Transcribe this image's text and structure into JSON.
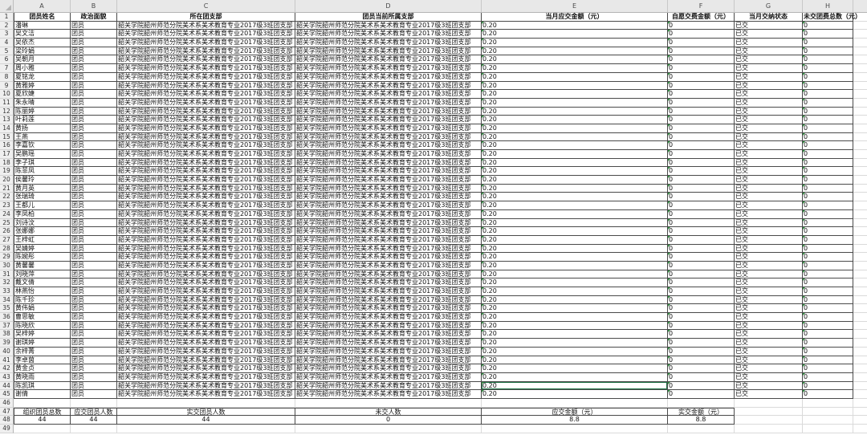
{
  "column_letters": [
    "A",
    "B",
    "C",
    "D",
    "E",
    "F",
    "G",
    "H"
  ],
  "row_numbers": [
    1,
    2,
    3,
    4,
    5,
    6,
    7,
    8,
    9,
    10,
    11,
    12,
    13,
    14,
    15,
    16,
    17,
    18,
    19,
    20,
    21,
    22,
    23,
    24,
    25,
    26,
    27,
    28,
    29,
    30,
    31,
    32,
    33,
    34,
    35,
    36,
    37,
    38,
    39,
    40,
    41,
    42,
    43,
    44,
    45,
    46,
    47,
    48,
    49
  ],
  "headers": [
    "团员姓名",
    "政治面貌",
    "所在团支部",
    "团员当前所属支部",
    "当月应交金额（元）",
    "自愿交费金额（元）",
    "当月交纳状态",
    "未交团费总数（元）"
  ],
  "rows": [
    [
      "潘琳",
      "团员",
      "韶关学院韶州师范分院美术系美术教育专业2017级3班团支部",
      "韶关学院韶州师范分院美术系美术教育专业2017级3班团支部",
      "0.20",
      "0",
      "已交",
      "0"
    ],
    [
      "吴文洁",
      "团员",
      "韶关学院韶州师范分院美术系美术教育专业2017级3班团支部",
      "韶关学院韶州师范分院美术系美术教育专业2017级3班团支部",
      "0.20",
      "0",
      "已交",
      "0"
    ],
    [
      "吴依杰",
      "团员",
      "韶关学院韶州师范分院美术系美术教育专业2017级3班团支部",
      "韶关学院韶州师范分院美术系美术教育专业2017级3班团支部",
      "0.20",
      "0",
      "已交",
      "0"
    ],
    [
      "梁玲娟",
      "团员",
      "韶关学院韶州师范分院美术系美术教育专业2017级3班团支部",
      "韶关学院韶州师范分院美术系美术教育专业2017级3班团支部",
      "0.20",
      "0",
      "已交",
      "0"
    ],
    [
      "吴朝月",
      "团员",
      "韶关学院韶州师范分院美术系美术教育专业2017级3班团支部",
      "韶关学院韶州师范分院美术系美术教育专业2017级3班团支部",
      "0.20",
      "0",
      "已交",
      "0"
    ],
    [
      "周小雅",
      "团员",
      "韶关学院韶州师范分院美术系美术教育专业2017级3班团支部",
      "韶关学院韶州师范分院美术系美术教育专业2017级3班团支部",
      "0.20",
      "0",
      "已交",
      "0"
    ],
    [
      "夏铭龙",
      "团员",
      "韶关学院韶州师范分院美术系美术教育专业2017级3班团支部",
      "韶关学院韶州师范分院美术系美术教育专业2017级3班团支部",
      "0.20",
      "0",
      "已交",
      "0"
    ],
    [
      "黄雅婷",
      "团员",
      "韶关学院韶州师范分院美术系美术教育专业2017级3班团支部",
      "韶关学院韶州师范分院美术系美术教育专业2017级3班团支部",
      "0.20",
      "0",
      "已交",
      "0"
    ],
    [
      "夏欣婕",
      "团员",
      "韶关学院韶州师范分院美术系美术教育专业2017级3班团支部",
      "韶关学院韶州师范分院美术系美术教育专业2017级3班团支部",
      "0.20",
      "0",
      "已交",
      "0"
    ],
    [
      "朱永晴",
      "团员",
      "韶关学院韶州师范分院美术系美术教育专业2017级3班团支部",
      "韶关学院韶州师范分院美术系美术教育专业2017级3班团支部",
      "0.20",
      "0",
      "已交",
      "0"
    ],
    [
      "陈丽婷",
      "团员",
      "韶关学院韶州师范分院美术系美术教育专业2017级3班团支部",
      "韶关学院韶州师范分院美术系美术教育专业2017级3班团支部",
      "0.20",
      "0",
      "已交",
      "0"
    ],
    [
      "叶莉莲",
      "团员",
      "韶关学院韶州师范分院美术系美术教育专业2017级3班团支部",
      "韶关学院韶州师范分院美术系美术教育专业2017级3班团支部",
      "0.20",
      "0",
      "已交",
      "0"
    ],
    [
      "黄扬",
      "团员",
      "韶关学院韶州师范分院美术系美术教育专业2017级3班团支部",
      "韶关学院韶州师范分院美术系美术教育专业2017级3班团支部",
      "0.20",
      "0",
      "已交",
      "0"
    ],
    [
      "王燕",
      "团员",
      "韶关学院韶州师范分院美术系美术教育专业2017级3班团支部",
      "韶关学院韶州师范分院美术系美术教育专业2017级3班团支部",
      "0.20",
      "0",
      "已交",
      "0"
    ],
    [
      "李嘉钦",
      "团员",
      "韶关学院韶州师范分院美术系美术教育专业2017级3班团支部",
      "韶关学院韶州师范分院美术系美术教育专业2017级3班团支部",
      "0.20",
      "0",
      "已交",
      "0"
    ],
    [
      "吴鹏瑶",
      "团员",
      "韶关学院韶州师范分院美术系美术教育专业2017级3班团支部",
      "韶关学院韶州师范分院美术系美术教育专业2017级3班团支部",
      "0.20",
      "0",
      "已交",
      "0"
    ],
    [
      "李子琪",
      "团员",
      "韶关学院韶州师范分院美术系美术教育专业2017级3班团支部",
      "韶关学院韶州师范分院美术系美术教育专业2017级3班团支部",
      "0.20",
      "0",
      "已交",
      "0"
    ],
    [
      "陈菲凤",
      "团员",
      "韶关学院韶州师范分院美术系美术教育专业2017级3班团支部",
      "韶关学院韶州师范分院美术系美术教育专业2017级3班团支部",
      "0.20",
      "0",
      "已交",
      "0"
    ],
    [
      "侯馨玲",
      "团员",
      "韶关学院韶州师范分院美术系美术教育专业2017级3班团支部",
      "韶关学院韶州师范分院美术系美术教育专业2017级3班团支部",
      "0.20",
      "0",
      "已交",
      "0"
    ],
    [
      "黄月英",
      "团员",
      "韶关学院韶州师范分院美术系美术教育专业2017级3班团支部",
      "韶关学院韶州师范分院美术系美术教育专业2017级3班团支部",
      "0.20",
      "0",
      "已交",
      "0"
    ],
    [
      "张瑞琦",
      "团员",
      "韶关学院韶州师范分院美术系美术教育专业2017级3班团支部",
      "韶关学院韶州师范分院美术系美术教育专业2017级3班团支部",
      "0.20",
      "0",
      "已交",
      "0"
    ],
    [
      "王都儿",
      "团员",
      "韶关学院韶州师范分院美术系美术教育专业2017级3班团支部",
      "韶关学院韶州师范分院美术系美术教育专业2017级3班团支部",
      "0.20",
      "0",
      "已交",
      "0"
    ],
    [
      "李凤柏",
      "团员",
      "韶关学院韶州师范分院美术系美术教育专业2017级3班团支部",
      "韶关学院韶州师范分院美术系美术教育专业2017级3班团支部",
      "0.20",
      "0",
      "已交",
      "0"
    ],
    [
      "刘诗汶",
      "团员",
      "韶关学院韶州师范分院美术系美术教育专业2017级3班团支部",
      "韶关学院韶州师范分院美术系美术教育专业2017级3班团支部",
      "0.20",
      "0",
      "已交",
      "0"
    ],
    [
      "张娜娜",
      "团员",
      "韶关学院韶州师范分院美术系美术教育专业2017级3班团支部",
      "韶关学院韶州师范分院美术系美术教育专业2017级3班团支部",
      "0.20",
      "0",
      "已交",
      "0"
    ],
    [
      "王梓虹",
      "团员",
      "韶关学院韶州师范分院美术系美术教育专业2017级3班团支部",
      "韶关学院韶州师范分院美术系美术教育专业2017级3班团支部",
      "0.20",
      "0",
      "已交",
      "0"
    ],
    [
      "吴婧婷",
      "团员",
      "韶关学院韶州师范分院美术系美术教育专业2017级3班团支部",
      "韶关学院韶州师范分院美术系美术教育专业2017级3班团支部",
      "0.20",
      "0",
      "已交",
      "0"
    ],
    [
      "陈婉彤",
      "团员",
      "韶关学院韶州师范分院美术系美术教育专业2017级3班团支部",
      "韶关学院韶州师范分院美术系美术教育专业2017级3班团支部",
      "0.20",
      "0",
      "已交",
      "0"
    ],
    [
      "黄馨馨",
      "团员",
      "韶关学院韶州师范分院美术系美术教育专业2017级3班团支部",
      "韶关学院韶州师范分院美术系美术教育专业2017级3班团支部",
      "0.20",
      "0",
      "已交",
      "0"
    ],
    [
      "刘晓萍",
      "团员",
      "韶关学院韶州师范分院美术系美术教育专业2017级3班团支部",
      "韶关学院韶州师范分院美术系美术教育专业2017级3班团支部",
      "0.20",
      "0",
      "已交",
      "0"
    ],
    [
      "戴文倩",
      "团员",
      "韶关学院韶州师范分院美术系美术教育专业2017级3班团支部",
      "韶关学院韶州师范分院美术系美术教育专业2017级3班团支部",
      "0.20",
      "0",
      "已交",
      "0"
    ],
    [
      "林燕怡",
      "团员",
      "韶关学院韶州师范分院美术系美术教育专业2017级3班团支部",
      "韶关学院韶州师范分院美术系美术教育专业2017级3班团支部",
      "0.20",
      "0",
      "已交",
      "0"
    ],
    [
      "陈千珍",
      "团员",
      "韶关学院韶州师范分院美术系美术教育专业2017级3班团支部",
      "韶关学院韶州师范分院美术系美术教育专业2017级3班团支部",
      "0.20",
      "0",
      "已交",
      "0"
    ],
    [
      "黄伟娟",
      "团员",
      "韶关学院韶州师范分院美术系美术教育专业2017级3班团支部",
      "韶关学院韶州师范分院美术系美术教育专业2017级3班团支部",
      "0.20",
      "0",
      "已交",
      "0"
    ],
    [
      "曹思敏",
      "团员",
      "韶关学院韶州师范分院美术系美术教育专业2017级3班团支部",
      "韶关学院韶州师范分院美术系美术教育专业2017级3班团支部",
      "0.20",
      "0",
      "已交",
      "0"
    ],
    [
      "陈晓欣",
      "团员",
      "韶关学院韶州师范分院美术系美术教育专业2017级3班团支部",
      "韶关学院韶州师范分院美术系美术教育专业2017级3班团支部",
      "0.20",
      "0",
      "已交",
      "0"
    ],
    [
      "吴梓婷",
      "团员",
      "韶关学院韶州师范分院美术系美术教育专业2017级3班团支部",
      "韶关学院韶州师范分院美术系美术教育专业2017级3班团支部",
      "0.20",
      "0",
      "已交",
      "0"
    ],
    [
      "谢琪婷",
      "团员",
      "韶关学院韶州师范分院美术系美术教育专业2017级3班团支部",
      "韶关学院韶州师范分院美术系美术教育专业2017级3班团支部",
      "0.20",
      "0",
      "已交",
      "0"
    ],
    [
      "余梓菁",
      "团员",
      "韶关学院韶州师范分院美术系美术教育专业2017级3班团支部",
      "韶关学院韶州师范分院美术系美术教育专业2017级3班团支部",
      "0.20",
      "0",
      "已交",
      "0"
    ],
    [
      "李卓茵",
      "团员",
      "韶关学院韶州师范分院美术系美术教育专业2017级3班团支部",
      "韶关学院韶州师范分院美术系美术教育专业2017级3班团支部",
      "0.20",
      "0",
      "已交",
      "0"
    ],
    [
      "黄金贞",
      "团员",
      "韶关学院韶州师范分院美术系美术教育专业2017级3班团支部",
      "韶关学院韶州师范分院美术系美术教育专业2017级3班团支部",
      "0.20",
      "0",
      "已交",
      "0"
    ],
    [
      "黄晓雨",
      "团员",
      "韶关学院韶州师范分院美术系美术教育专业2017级3班团支部",
      "韶关学院韶州师范分院美术系美术教育专业2017级3班团支部",
      "0.20",
      "0",
      "已交",
      "0"
    ],
    [
      "陈凯琪",
      "团员",
      "韶关学院韶州师范分院美术系美术教育专业2017级3班团支部",
      "韶关学院韶州师范分院美术系美术教育专业2017级3班团支部",
      "0.20",
      "0",
      "已交",
      "0"
    ],
    [
      "谢倩",
      "团员",
      "韶关学院韶州师范分院美术系美术教育专业2017级3班团支部",
      "韶关学院韶州师范分院美术系美术教育专业2017级3班团支部",
      "0.20",
      "0",
      "已交",
      "0"
    ]
  ],
  "summary": {
    "labels": [
      "组织团员总数",
      "应交团员人数",
      "实交团员人数",
      "未交人数",
      "应交金额（元）",
      "实交金额（元）"
    ],
    "values": [
      "44",
      "44",
      "44",
      "0",
      "8.8",
      "8.8"
    ]
  },
  "colors": {
    "table_border": "#4a4a4a",
    "gridline": "#dadada",
    "header_background": "#e8e8e8",
    "text_number_flag": "#2e8b3e",
    "active_cell_border": "#1e7145"
  }
}
